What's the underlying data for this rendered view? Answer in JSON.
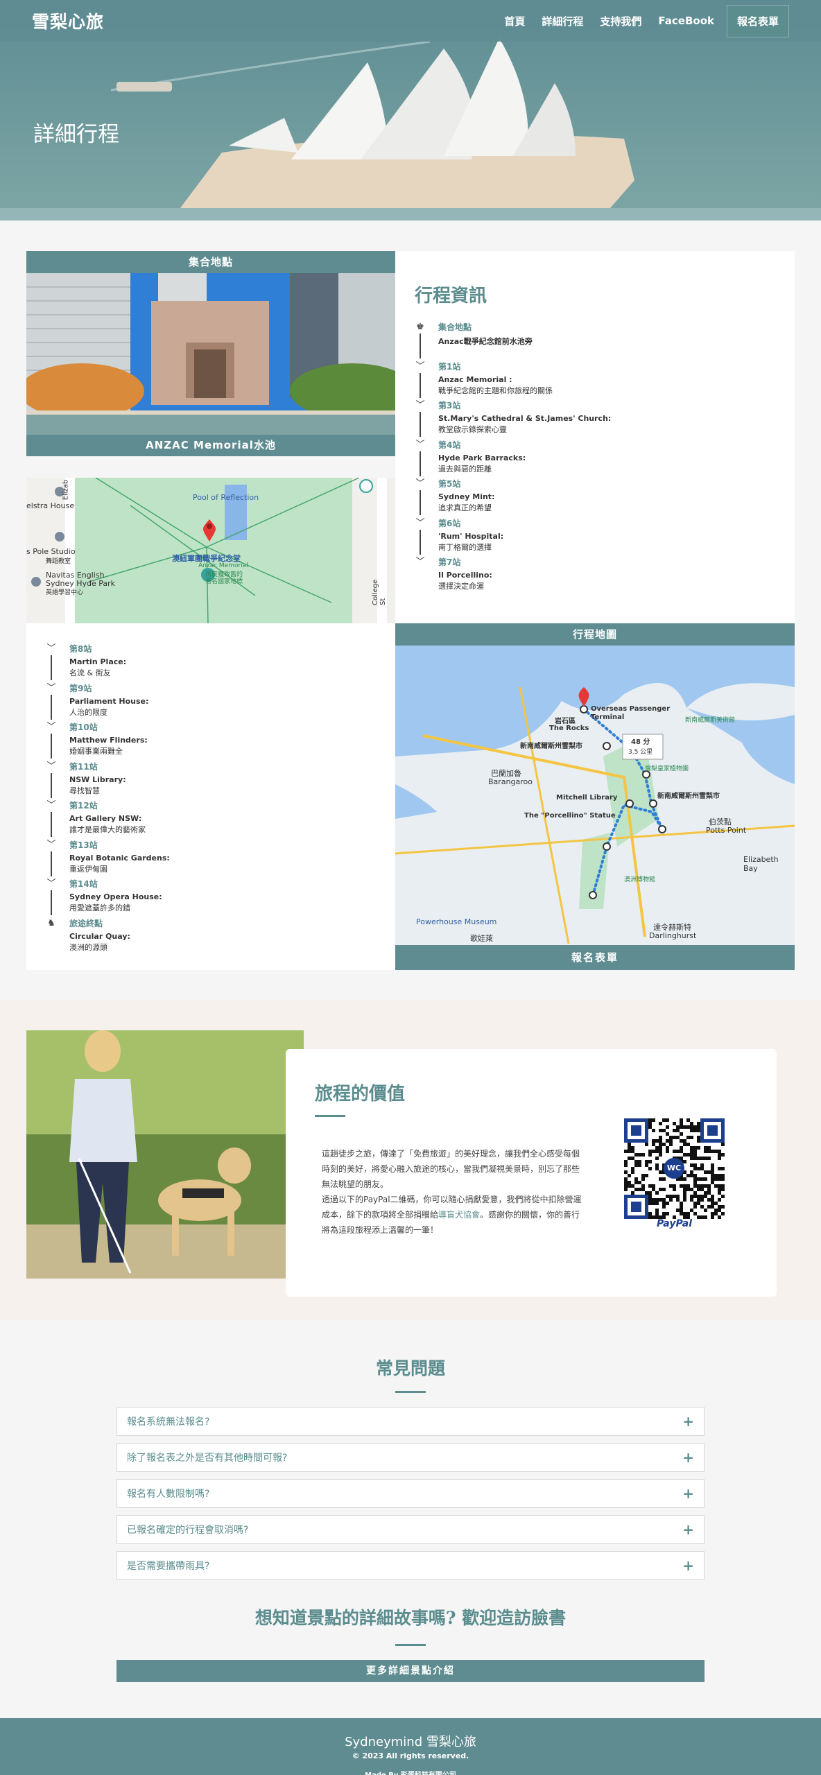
{
  "header": {
    "brand": "雪梨心旅",
    "nav": [
      "首頁",
      "詳細行程",
      "支持我們",
      "FaceBook"
    ],
    "cta": "報名表單"
  },
  "hero": {
    "title": "詳細行程"
  },
  "meeting": {
    "header": "集合地點",
    "caption": "ANZAC Memorial水池"
  },
  "map1_labels": {
    "pool": "Pool of Reflection",
    "memorial": "澳紐軍團戰爭紀念堂",
    "memorial_en": "Anzac Memorial",
    "memorial_sub1": "再度獲致舊的",
    "memorial_sub2": "著名國家地標",
    "house": "elstra House",
    "studio": "s Pole Studio",
    "studio_sub": "舞蹈教室",
    "navitas1": "Navitas English",
    "navitas2": "Sydney Hyde Park",
    "navitas3": "英語學習中心",
    "college": "College St",
    "elizab": "Elizab"
  },
  "itinerary": {
    "title": "行程資訊",
    "items": [
      {
        "stop": "集合地點",
        "place": "Anzac戰爭紀念館前水池旁",
        "desc": ""
      },
      {
        "stop": "第1站",
        "place": "Anzac Memorial :",
        "desc": "戰爭紀念館的主題和你旅程的關係"
      },
      {
        "stop": "第3站",
        "place": "St.Mary's Cathedral & St.James' Church:",
        "desc": "教堂啟示錄探索心靈"
      },
      {
        "stop": "第4站",
        "place": "Hyde Park Barracks:",
        "desc": "過去與惡的距離"
      },
      {
        "stop": "第5站",
        "place": "Sydney Mint:",
        "desc": "追求真正的希望"
      },
      {
        "stop": "第6站",
        "place": "'Rum' Hospital:",
        "desc": "南丁格爾的選擇"
      },
      {
        "stop": "第7站",
        "place": "Il Porcellino:",
        "desc": "選擇決定命運"
      }
    ],
    "more": [
      {
        "stop": "第8站",
        "place": "Martin Place:",
        "desc": "名流 & 街友"
      },
      {
        "stop": "第9站",
        "place": "Parliament House:",
        "desc": "人治的限度"
      },
      {
        "stop": "第10站",
        "place": "Matthew Flinders:",
        "desc": "婚姻事業兩難全"
      },
      {
        "stop": "第11站",
        "place": "NSW Library:",
        "desc": "尋找智慧"
      },
      {
        "stop": "第12站",
        "place": "Art Gallery NSW:",
        "desc": "誰才是最偉大的藝術家"
      },
      {
        "stop": "第13站",
        "place": "Royal Botanic Gardens:",
        "desc": "重返伊甸園"
      },
      {
        "stop": "第14站",
        "place": "Sydney Opera House:",
        "desc": "用愛遮蓋許多的錯"
      },
      {
        "stop": "旅途終點",
        "place": "Circular Quay:",
        "desc": "澳洲的源頭"
      }
    ]
  },
  "route_map": {
    "header": "行程地圖",
    "button": "報名表單",
    "labels": {
      "terminal1": "Overseas Passenger",
      "terminal2": "Terminal",
      "rocks1": "岩石區",
      "rocks2": "The Rocks",
      "nsw": "新南威爾斯州雪梨市",
      "nsw2": "新南威爾斯州雪梨市",
      "barangaroo1": "巴蘭加魯",
      "barangaroo2": "Barangaroo",
      "mitchell": "Mitchell Library",
      "porcellino": "The \"Porcellino\" Statue",
      "potts1": "伯茨點",
      "potts2": "Potts Point",
      "eliz": "Elizabeth Bay",
      "darl1": "達令赫斯特",
      "darl2": "Darlinghurst",
      "powerhouse": "Powerhouse Museum",
      "haymarket": "歌娃萊",
      "botanic": "雪梨皇家植物園",
      "gallery": "新南威爾斯美術館",
      "museum": "澳洲博物館",
      "time": "48 分",
      "dist": "3.5 公里"
    }
  },
  "value": {
    "title": "旅程的價值",
    "p1": "這趟徒步之旅，傳達了「免費旅遊」的美好理念，讓我們全心感受每個時刻的美好，將愛心融入旅途的核心，當我們凝視美景時，別忘了那些無法眺望的朋友。",
    "p2_a": "透過以下的PayPal二維碼，你可以隨心捐獻愛意，我們將從中扣除營運成本，餘下的款項將全部捐贈給",
    "p2_hl": "導盲犬協會",
    "p2_b": "。感謝你的關懷，你的善行將為這段旅程添上溫馨的一筆！",
    "qr_center": "WC",
    "qr_brand": "PayPal"
  },
  "faq": {
    "title": "常見問題",
    "items": [
      "報名系統無法報名?",
      "除了報名表之外是否有其他時間可報?",
      "報名有人數限制嗎?",
      "已報名確定的行程會取消嗎?",
      "是否需要攜帶雨具?"
    ],
    "plus": "+"
  },
  "facebook": {
    "title": "想知道景點的詳細故事嗎? 歡迎造訪臉書",
    "button": "更多詳細景點介紹"
  },
  "footer": {
    "brand": "Sydneymind 雪梨心旅",
    "copy": "© 2023 All rights reserved.",
    "made": "Made By 彩蛋科技有限公司"
  },
  "colors": {
    "accent": "#5b8c8e",
    "header": "#608c92",
    "beige": "#f6f1ed"
  }
}
